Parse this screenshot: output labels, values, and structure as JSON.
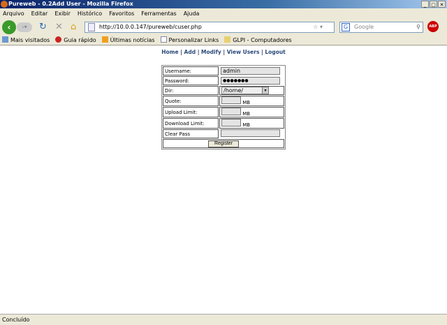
{
  "window": {
    "title": "Pureweb - 0.2Add User - Mozilla Firefox",
    "controls": [
      "_",
      "□",
      "✕"
    ]
  },
  "menu": [
    "Arquivo",
    "Editar",
    "Exibir",
    "Histórico",
    "Favoritos",
    "Ferramentas",
    "Ajuda"
  ],
  "nav": {
    "url": "http://10.0.0.147/pureweb/cuser.php",
    "search_placeholder": "Google",
    "adblock": "ABP"
  },
  "bookmarks": [
    "Mais visitados",
    "Guia rápido",
    "Últimas notícias",
    "Personalizar Links",
    "GLPI - Computadores"
  ],
  "links": [
    "Home",
    "Add",
    "Modify",
    "View Users",
    "Logout"
  ],
  "form": {
    "username_label": "Username:",
    "username_value": "admin",
    "password_label": "Password:",
    "password_value": "●●●●●●●",
    "dir_label": "Dir:",
    "dir_value": "/home/",
    "quote_label": "Quote:",
    "upload_label": "Upload Limit:",
    "download_label": "Download Limit:",
    "unit": "MB",
    "clear_label": "Clear Pass",
    "register": "Register"
  },
  "status": "Concluído"
}
